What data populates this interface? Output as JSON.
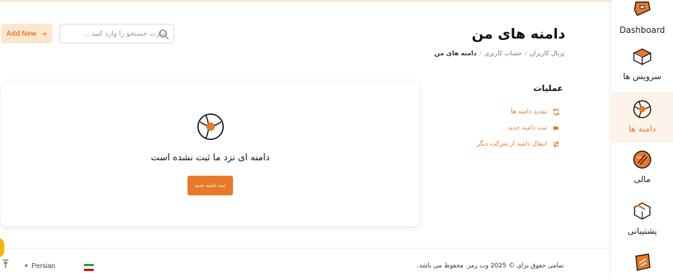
{
  "header": {
    "title": "دامنه های من",
    "add_button": "Add New",
    "search_placeholder": "عبارت جستجو را وارد کنید .."
  },
  "breadcrumb": [
    "پرتال کاربران",
    "حساب کاربری",
    "دامنه های من"
  ],
  "operations": {
    "title": "عملیات",
    "items": [
      {
        "label": "تمدید دامنه ها",
        "icon": "refresh-icon"
      },
      {
        "label": "ثبت دامنه جدید",
        "icon": "tag-icon"
      },
      {
        "label": "انتقال دامنه از شرکت دیگر",
        "icon": "transfer-icon"
      }
    ]
  },
  "empty_state": {
    "message": "دامنه ای نزد ما ثبت نشده است",
    "button": "ثبت دامنه جدید"
  },
  "sidebar": {
    "items": [
      {
        "label": "Dashboard",
        "icon": "dashboard-icon",
        "active": false
      },
      {
        "label": "سرویس ها",
        "icon": "services-box-icon",
        "active": false
      },
      {
        "label": "دامنه ها",
        "icon": "globe-icon",
        "active": true
      },
      {
        "label": "مالی",
        "icon": "finance-icon",
        "active": false
      },
      {
        "label": "پشتیبانی",
        "icon": "support-icon",
        "active": false
      },
      {
        "label": "",
        "icon": "more-icon",
        "active": false
      }
    ]
  },
  "footer": {
    "copyright": "تمامی حقوق برای © 2025 وب رمز. محفوظ می باشد.",
    "language": "Persian"
  },
  "colors": {
    "accent": "#e8792a",
    "accent_light": "#fde6cf",
    "active_bg": "#fdf3ea"
  }
}
